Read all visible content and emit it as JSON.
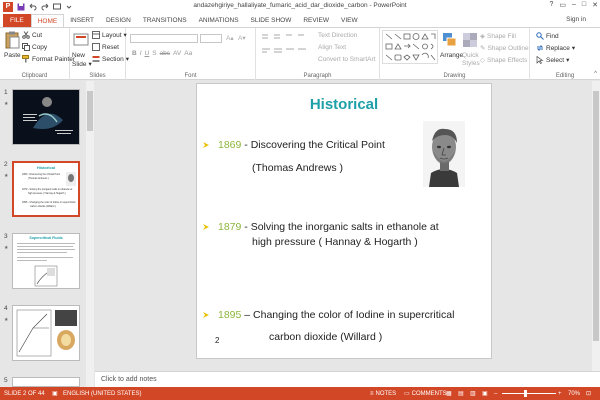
{
  "window": {
    "title": "andazehgiriye_hallaliyate_fumaric_acid_dar_dioxide_carbon - PowerPoint",
    "sign_in": "Sign in"
  },
  "tabs": [
    {
      "label": "FILE"
    },
    {
      "label": "HOME"
    },
    {
      "label": "INSERT"
    },
    {
      "label": "DESIGN"
    },
    {
      "label": "TRANSITIONS"
    },
    {
      "label": "ANIMATIONS"
    },
    {
      "label": "SLIDE SHOW"
    },
    {
      "label": "REVIEW"
    },
    {
      "label": "VIEW"
    }
  ],
  "ribbon": {
    "clipboard": {
      "label": "Clipboard",
      "paste": "Paste",
      "cut": "Cut",
      "copy": "Copy",
      "format_painter": "Format Painter"
    },
    "slides": {
      "label": "Slides",
      "new_slide": "New",
      "new_slide2": "Slide",
      "layout": "Layout",
      "reset": "Reset",
      "section": "Section"
    },
    "font": {
      "label": "Font",
      "bold": "B",
      "italic": "I",
      "underline": "U",
      "shadow": "S",
      "strike": "abc",
      "spacing": "AV",
      "case": "Aa"
    },
    "paragraph": {
      "label": "Paragraph",
      "text_direction": "Text Direction",
      "align_text": "Align Text",
      "convert_smartart": "Convert to SmartArt"
    },
    "drawing": {
      "label": "Drawing",
      "arrange": "Arrange",
      "quick_styles": "Quick",
      "quick_styles2": "Styles",
      "shape_fill": "Shape Fill",
      "shape_outline": "Shape Outline",
      "shape_effects": "Shape Effects"
    },
    "editing": {
      "label": "Editing",
      "find": "Find",
      "replace": "Replace",
      "select": "Select"
    }
  },
  "thumbnails": [
    {
      "num": "1"
    },
    {
      "num": "2"
    },
    {
      "num": "3"
    },
    {
      "num": "4"
    },
    {
      "num": "5"
    }
  ],
  "thumb2": {
    "title": "Historical",
    "l1": "1869 - Discovering the Critical Point",
    "l2": "(Thomas Andrews )",
    "l3": "1879 - Solving the inorganic salts in ethanole at",
    "l4": "high pressure ( Hannay & Hogarth )",
    "l5": "1895 - Changing the color of Iodine in supercritical",
    "l6": "carbon dioxide (Willard )"
  },
  "thumb3": {
    "title": "Supercritical Fluids"
  },
  "slide": {
    "title": "Historical",
    "items": [
      {
        "year": "1869",
        "text": " - Discovering the Critical Point",
        "sub": "(Thomas Andrews )"
      },
      {
        "year": "1879",
        "text": " - Solving the inorganic salts in ethanole at",
        "sub": "high pressure ( Hannay & Hogarth )"
      },
      {
        "year": "1895",
        "text": " – Changing the color of Iodine in supercritical",
        "sub": "carbon dioxide (Willard )"
      }
    ],
    "number": "2"
  },
  "notes": {
    "placeholder": "Click to add notes"
  },
  "status": {
    "slide": "SLIDE 2 OF 44",
    "language": "ENGLISH (UNITED STATES)",
    "notes": "NOTES",
    "comments": "COMMENTS",
    "zoom": "70%"
  },
  "colors": {
    "accent": "#d24726",
    "title": "#1fa0a8",
    "year": "#8db63c",
    "bullet": "#e8c000"
  }
}
